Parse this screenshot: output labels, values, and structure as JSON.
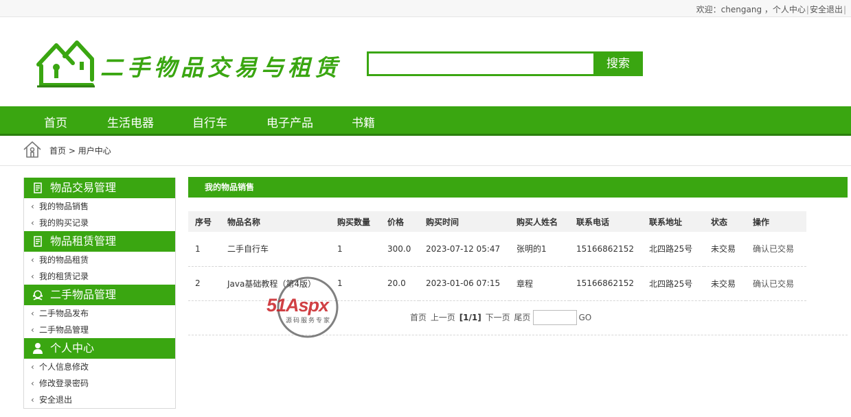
{
  "topbar": {
    "welcome": "欢迎：chengang ，",
    "user_center": "个人中心",
    "logout": "安全退出"
  },
  "header": {
    "title": "二手物品交易与租赁",
    "search_value": "",
    "search_label": "搜索"
  },
  "nav": [
    "首页",
    "生活电器",
    "自行车",
    "电子产品",
    "书籍"
  ],
  "breadcrumb": {
    "home": "首页",
    "sep": ">",
    "current": "用户中心"
  },
  "sidebar": [
    {
      "title": "物品交易管理",
      "icon": "document-icon",
      "items": [
        "我的物品销售",
        "我的购买记录"
      ]
    },
    {
      "title": "物品租赁管理",
      "icon": "document-icon",
      "items": [
        "我的物品租赁",
        "我的租赁记录"
      ]
    },
    {
      "title": "二手物品管理",
      "icon": "headset-icon",
      "items": [
        "二手物品发布",
        "二手物品管理"
      ]
    },
    {
      "title": "个人中心",
      "icon": "user-icon",
      "items": [
        "个人信息修改",
        "修改登录密码",
        "安全退出"
      ]
    }
  ],
  "content": {
    "title": "我的物品销售",
    "columns": [
      "序号",
      "物品名称",
      "购买数量",
      "价格",
      "购买时间",
      "购买人姓名",
      "联系电话",
      "联系地址",
      "状态",
      "操作"
    ],
    "rows": [
      [
        "1",
        "二手自行车",
        "1",
        "300.0",
        "2023-07-12 05:47",
        "张明的1",
        "15166862152",
        "北四路25号",
        "未交易",
        "确认已交易"
      ],
      [
        "2",
        "Java基础教程（第4版）",
        "1",
        "20.0",
        "2023-01-06 07:15",
        "章程",
        "15166862152",
        "北四路25号",
        "未交易",
        "确认已交易"
      ]
    ]
  },
  "pager": {
    "first": "首页",
    "prev": "上一页",
    "current": "[1/1]",
    "next": "下一页",
    "last": "尾页",
    "go": "GO"
  },
  "watermark": {
    "brand": "51Aspx",
    "tagline": "源码服务专家"
  },
  "colors": {
    "accent": "#3aa611",
    "accent_dark": "#2b7f0e"
  }
}
